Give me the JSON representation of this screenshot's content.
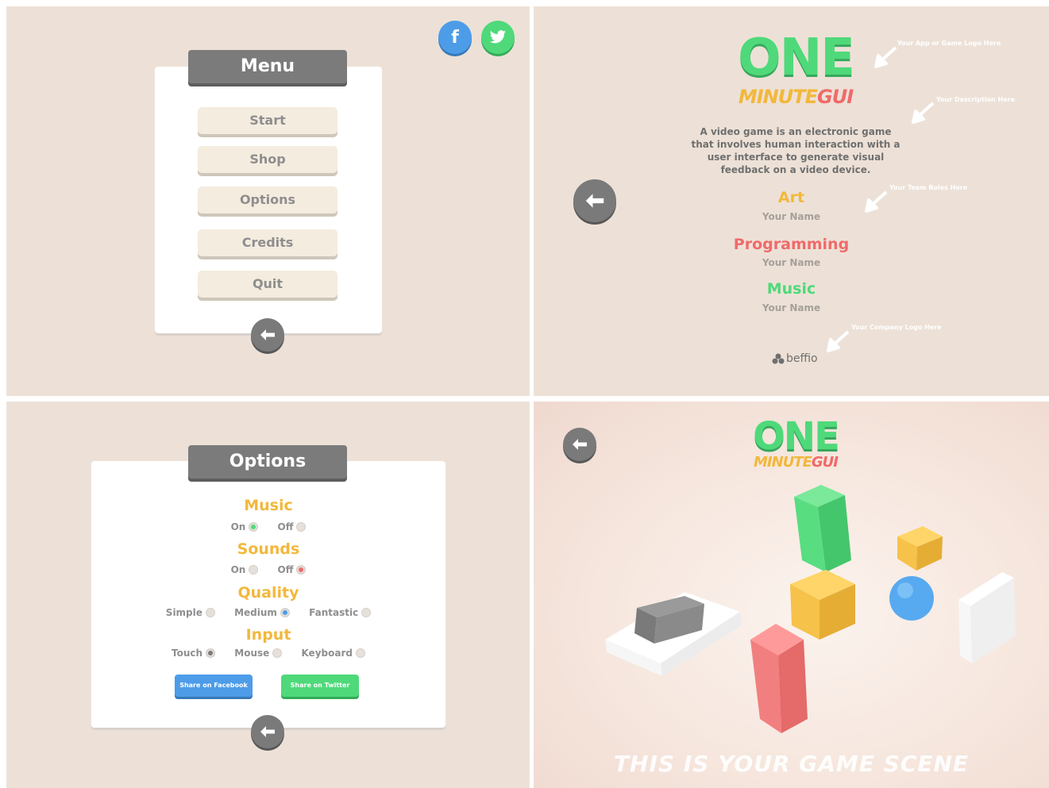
{
  "menu_screen": {
    "title": "Menu",
    "buttons": [
      "Start",
      "Shop",
      "Options",
      "Credits",
      "Quit"
    ],
    "social": {
      "facebook_glyph": "f"
    }
  },
  "credits_screen": {
    "logo_main": "ONE",
    "logo_sub_1": "MINUTE",
    "logo_sub_2": "GUI",
    "description": "A video game is an electronic game that involves human interaction with a user interface to generate visual feedback on a video device.",
    "sections": [
      {
        "heading": "Art",
        "name": "Your Name",
        "color": "#f2b83c"
      },
      {
        "heading": "Programming",
        "name": "Your Name",
        "color": "#f06a6a"
      },
      {
        "heading": "Music",
        "name": "Your Name",
        "color": "#4fd97a"
      }
    ],
    "company_logo": "beffio",
    "notes": {
      "logo": "Your App or Game Logo Here",
      "description": "Your Description Here",
      "roles": "Your Team Roles Here",
      "company": "Your Company Logo Here"
    }
  },
  "options_screen": {
    "title": "Options",
    "groups": [
      {
        "heading": "Music",
        "options": [
          {
            "label": "On",
            "selected": true
          },
          {
            "label": "Off",
            "selected": false
          }
        ]
      },
      {
        "heading": "Sounds",
        "options": [
          {
            "label": "On",
            "selected": false
          },
          {
            "label": "Off",
            "selected": true
          }
        ]
      },
      {
        "heading": "Quality",
        "options": [
          {
            "label": "Simple",
            "selected": false
          },
          {
            "label": "Medium",
            "selected": true
          },
          {
            "label": "Fantastic",
            "selected": false
          }
        ]
      },
      {
        "heading": "Input",
        "options": [
          {
            "label": "Touch",
            "selected": true
          },
          {
            "label": "Mouse",
            "selected": false
          },
          {
            "label": "Keyboard",
            "selected": false
          }
        ]
      }
    ],
    "share_facebook": "Share on Facebook",
    "share_twitter": "Share on Twitter"
  },
  "game_screen": {
    "logo_main": "ONE",
    "logo_sub_1": "MINUTE",
    "logo_sub_2": "GUI",
    "caption": "THIS IS YOUR GAME SCENE"
  },
  "colors": {
    "background": "#ede1d7",
    "green": "#4fd97a",
    "yellow": "#f2b83c",
    "red": "#f06a6a",
    "blue": "#4d9ce8",
    "gray": "#7b7b7b"
  }
}
